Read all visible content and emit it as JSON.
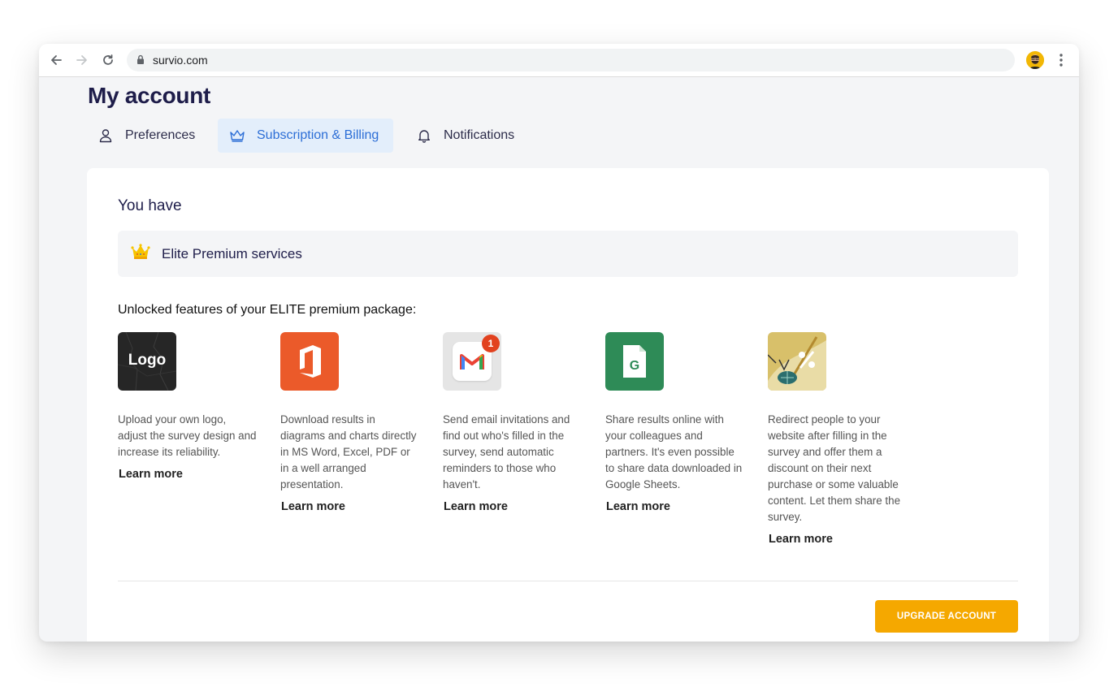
{
  "browser": {
    "url": "survio.com"
  },
  "page": {
    "title": "My account"
  },
  "tabs": [
    {
      "label": "Preferences",
      "icon": "user-icon",
      "active": false
    },
    {
      "label": "Subscription & Billing",
      "icon": "crown-icon",
      "active": true
    },
    {
      "label": "Notifications",
      "icon": "bell-icon",
      "active": false
    }
  ],
  "subscription": {
    "you_have": "You have",
    "plan_name": "Elite Premium services",
    "features_heading": "Unlocked features of your ELITE premium package:",
    "features": [
      {
        "icon": "logo-icon",
        "thumb_text": "Logo",
        "description": "Upload your own logo, adjust the survey design and increase its reliability.",
        "learn_more": "Learn more"
      },
      {
        "icon": "office-icon",
        "description": "Download results in diagrams and charts directly in MS Word, Excel, PDF or in a well arranged presentation.",
        "learn_more": "Learn more"
      },
      {
        "icon": "gmail-icon",
        "badge": "1",
        "description": "Send email invitations and find out who's filled in the survey, send automatic reminders to those who haven't.",
        "learn_more": "Learn more"
      },
      {
        "icon": "google-sheets-icon",
        "description": "Share results online with your colleagues and partners. It's even possible to share data downloaded in Google Sheets.",
        "learn_more": "Learn more"
      },
      {
        "icon": "discount-redirect-icon",
        "description": "Redirect people to your website after filling in the survey and offer them a discount on their next purchase or some valuable content. Let them share the survey.",
        "learn_more": "Learn more"
      }
    ],
    "upgrade_button": "UPGRADE ACCOUNT"
  },
  "colors": {
    "accent": "#2c6ed6",
    "upgrade": "#f5a800",
    "title": "#1e1d4a"
  }
}
